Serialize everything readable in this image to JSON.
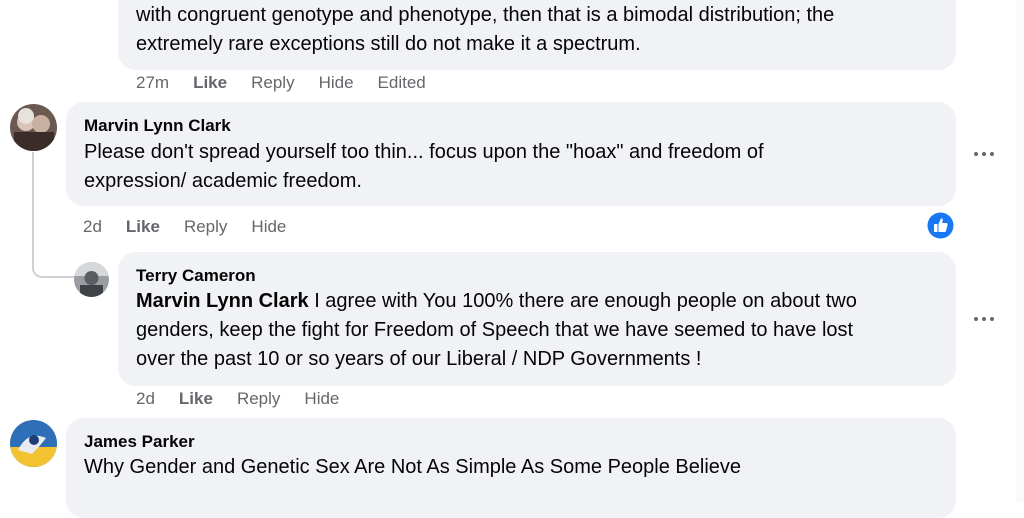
{
  "comments": [
    {
      "text_lines": [
        "with congruent genotype and phenotype, then that is a bimodal distribution; the",
        "extremely rare exceptions still do not make it a spectrum."
      ],
      "actions": {
        "time": "27m",
        "like": "Like",
        "reply": "Reply",
        "hide": "Hide",
        "edited": "Edited"
      }
    },
    {
      "author": "Marvin Lynn Clark",
      "text_lines": [
        "Please don't spread yourself too thin... focus upon the \"hoax\" and freedom of",
        "expression/ academic freedom."
      ],
      "actions": {
        "time": "2d",
        "like": "Like",
        "reply": "Reply",
        "hide": "Hide"
      },
      "reaction_icon": "thumbs-up-icon"
    },
    {
      "author": "Terry Cameron",
      "mention": "Marvin Lynn Clark",
      "text_lines": [
        " I agree with You 100% there are enough people on about two",
        "genders, keep the fight for Freedom of Speech that we have seemed to have lost",
        "over the past 10 or so years of our Liberal / NDP Governments !"
      ],
      "actions": {
        "time": "2d",
        "like": "Like",
        "reply": "Reply",
        "hide": "Hide"
      }
    },
    {
      "author": "James Parker",
      "text_lines": [
        "Why Gender and Genetic Sex Are Not As Simple As Some People Believe"
      ]
    }
  ],
  "colors": {
    "bubble": "#f0f2f5",
    "meta": "#65676b",
    "reaction_blue": "#1877f2"
  }
}
